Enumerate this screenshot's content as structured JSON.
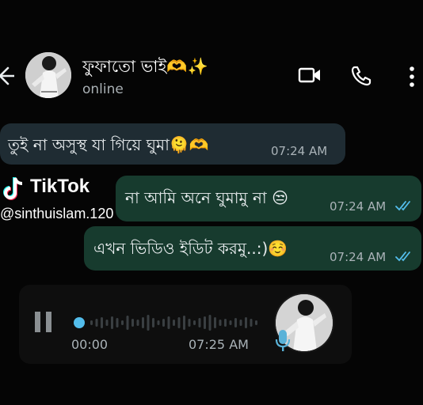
{
  "header": {
    "contact_name": "ফুফাতো ভাই🫶✨",
    "status": "online",
    "icons": [
      "back-arrow-icon",
      "video-call-icon",
      "phone-icon",
      "more-options-icon"
    ]
  },
  "messages": [
    {
      "direction": "incoming",
      "text": "তুই না অসুস্থ যা গিয়ে ঘুমা🫠🫶",
      "time": "07:24 AM"
    },
    {
      "direction": "outgoing",
      "text": "না আমি অনে ঘুমামু না 😒",
      "time": "07:24 AM",
      "read": true
    },
    {
      "direction": "outgoing",
      "text": "এখন ভিডিও ইডিট করমু..:)☺️",
      "time": "07:24 AM",
      "read": true
    }
  ],
  "voice_message": {
    "elapsed": "00:00",
    "time": "07:25 AM",
    "progress": 0.0
  },
  "watermark": {
    "brand": "TikTok",
    "handle": "@sinthuislam.120"
  },
  "colors": {
    "background": "#050505",
    "incoming_bubble": "#1f2c33",
    "outgoing_bubble": "#173b2e",
    "read_tick": "#53bdeb",
    "progress_dot": "#53bdeb",
    "mic": "#5ab2d8"
  }
}
